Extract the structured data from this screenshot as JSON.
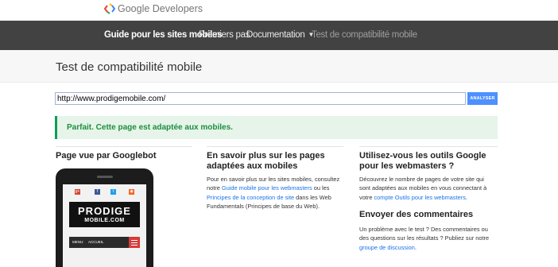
{
  "logo": {
    "text": "Google Developers",
    "icon": "google-developers-logo"
  },
  "nav": {
    "items": [
      {
        "label": "Guide pour les sites mobiles",
        "state": "active"
      },
      {
        "label": "Premiers pas",
        "state": "normal"
      },
      {
        "label": "Documentation",
        "state": "dropdown"
      },
      {
        "label": "Test de compatibilité mobile",
        "state": "current"
      }
    ]
  },
  "page": {
    "title": "Test de compatibilité mobile"
  },
  "url_form": {
    "value": "http://www.prodigemobile.com/",
    "button_label": "ANALYSER"
  },
  "result": {
    "message": "Parfait. Cette page est adaptée aux mobiles."
  },
  "col1": {
    "heading": "Page vue par Googlebot",
    "preview": {
      "brand_line1": "PRODIGE",
      "brand_line2": "MOBILE.COM",
      "menu_label": "MENU:",
      "menu_item": "ACCUEIL",
      "social_icons": [
        "google-plus-icon",
        "facebook-icon",
        "twitter-icon",
        "rss-icon"
      ],
      "social_glyphs": [
        "g+",
        "f",
        "t",
        "◉"
      ]
    }
  },
  "col2": {
    "heading": "En savoir plus sur les pages adaptées aux mobiles",
    "text_1": "Pour en savoir plus sur les sites mobiles, consultez notre ",
    "link_1": "Guide mobile pour les webmasters",
    "text_2": " ou les ",
    "link_2": "Principes de la conception de site",
    "text_3": " dans les Web Fundamentals (Principes de base du Web)."
  },
  "col3": {
    "heading": "Utilisez-vous les outils Google pour les webmasters ?",
    "text_1": "Découvrez le nombre de pages de votre site qui sont adaptées aux mobiles en vous connectant à votre ",
    "link_1": "compte Outils pour les webmasters",
    "text_2": ".",
    "feedback_heading": "Envoyer des commentaires",
    "feedback_text": "Un problème avec le test ? Des commentaires ou des questions sur les résultats ? Publiez sur notre ",
    "feedback_link": "groupe de discussion",
    "feedback_end": "."
  },
  "colors": {
    "nav_bg": "#424242",
    "accent": "#4d90fe",
    "success_bg": "#e6f4ea",
    "success_text": "#1e8e3e",
    "link": "#1a73e8"
  }
}
